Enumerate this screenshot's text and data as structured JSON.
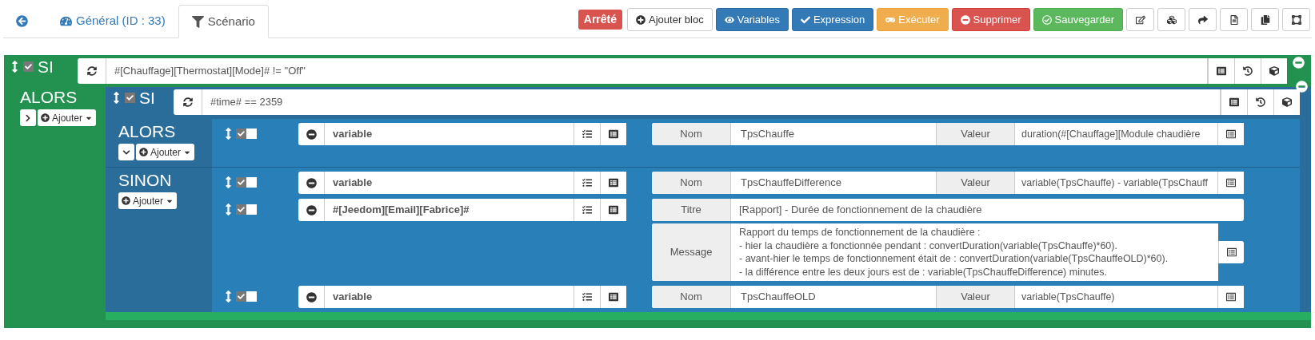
{
  "tabs": [
    {
      "kind": "back",
      "selected": false
    },
    {
      "kind": "general",
      "label": "Général (ID : 33)",
      "selected": false
    },
    {
      "kind": "scenario",
      "label": "Scénario",
      "selected": true
    }
  ],
  "status_badge": "Arrêté",
  "toolbar": [
    {
      "kind": "add",
      "label": "Ajouter bloc"
    },
    {
      "kind": "variables",
      "label": "Variables"
    },
    {
      "kind": "expression",
      "label": "Expression"
    },
    {
      "kind": "execute",
      "label": "Exécuter"
    },
    {
      "kind": "delete",
      "label": "Supprimer"
    },
    {
      "kind": "save",
      "label": "Sauvegarder"
    },
    {
      "kind": "edit"
    },
    {
      "kind": "cubes"
    },
    {
      "kind": "share"
    },
    {
      "kind": "file"
    },
    {
      "kind": "copy"
    },
    {
      "kind": "frame"
    }
  ],
  "block": {
    "keyword": "SI",
    "enabled": true,
    "condition": "#[Chauffage][Thermostat][Mode]# != \"Off\"",
    "branches": [
      {
        "label": "ALORS",
        "expanded": false,
        "add_label": "Ajouter",
        "blocks": [
          {
            "keyword": "SI",
            "enabled": true,
            "condition": "#time# == 2359",
            "branches": [
              {
                "label": "ALORS",
                "expanded": true,
                "add_label": "Ajouter",
                "actions": [
                  {
                    "kind": "variable",
                    "enabled": true,
                    "parallel": false,
                    "command": "variable",
                    "name_label": "Nom",
                    "name": "TpsChauffe",
                    "value_label": "Valeur",
                    "value": "duration(#[Chauffage][Module chaudière"
                  }
                ]
              },
              {
                "label": "SINON",
                "add_label": "Ajouter",
                "actions": [
                  {
                    "kind": "variable",
                    "enabled": true,
                    "parallel": false,
                    "command": "variable",
                    "name_label": "Nom",
                    "name": "TpsChauffeDifference",
                    "value_label": "Valeur",
                    "value": "variable(TpsChauffe) - variable(TpsChauff"
                  },
                  {
                    "kind": "message",
                    "enabled": true,
                    "parallel": false,
                    "command": "#[Jeedom][Email][Fabrice]#",
                    "title_label": "Titre",
                    "title": "[Rapport] - Durée de fonctionnement de la chaudière",
                    "message_label": "Message",
                    "lines": [
                      "Rapport du temps de fonctionnement de la chaudière :",
                      "- hier la chaudière a fonctionnée pendant : convertDuration(variable(TpsChauffe)*60).",
                      "- avant-hier le temps de fonctionnement était de : convertDuration(variable(TpsChauffeOLD)*60).",
                      "- la différence entre les deux jours est de : variable(TpsChauffeDifference) minutes."
                    ]
                  },
                  {
                    "kind": "variable",
                    "enabled": true,
                    "parallel": false,
                    "command": "variable",
                    "name_label": "Nom",
                    "name": "TpsChauffeOLD",
                    "value_label": "Valeur",
                    "value": "variable(TpsChauffe)"
                  }
                ]
              }
            ]
          }
        ]
      }
    ]
  }
}
